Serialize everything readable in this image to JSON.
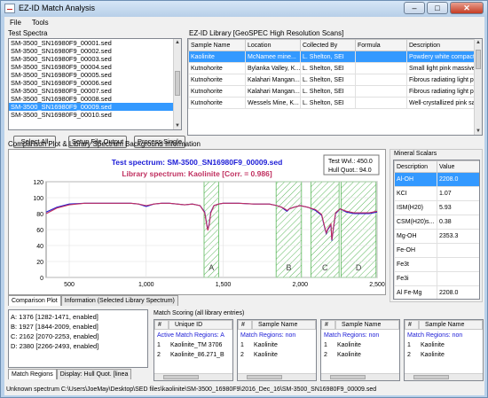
{
  "window": {
    "title": "EZ-ID Match Analysis"
  },
  "menu": {
    "file": "File",
    "tools": "Tools"
  },
  "test_spectra": {
    "label": "Test Spectra",
    "items": [
      "SM-3500_SN16980F9_00001.sed",
      "SM-3500_SN16980F9_00002.sed",
      "SM-3500_SN16980F9_00003.sed",
      "SM-3500_SN16980F9_00004.sed",
      "SM-3500_SN16980F9_00005.sed",
      "SM-3500_SN16980F9_00006.sed",
      "SM-3500_SN16980F9_00007.sed",
      "SM-3500_SN16980F9_00008.sed",
      "SM-3500_SN16980F9_00009.sed",
      "SM-3500_SN16980F9_00010.sed"
    ],
    "selected_index": 8
  },
  "buttons": {
    "select_all": "Select All",
    "setup_file_output": "Setup File Output",
    "process_single": "Process Single"
  },
  "library": {
    "label": "EZ-ID Library [GeoSPEC High Resolution Scans]",
    "columns": [
      "Sample Name",
      "Location",
      "Collected By",
      "Formula",
      "Description"
    ],
    "rows": [
      [
        "Kaolinite",
        "McNamee mine...",
        "L. Shelton, SEI",
        "",
        "Powdery white compact"
      ],
      [
        "Kutnohorite",
        "Bylanka Valley, K...",
        "L. Shelton, SEI",
        "",
        "Small light pink massive"
      ],
      [
        "Kutnohorite",
        "Kalahari Mangan...",
        "L. Shelton, SEI",
        "",
        "Fibrous radiating light pi"
      ],
      [
        "Kutnohorite",
        "Kalahari Mangan...",
        "L. Shelton, SEI",
        "",
        "Fibrous radiating light pi"
      ],
      [
        "Kutnohorite",
        "Wessels Mine, K...",
        "L. Shelton, SEI",
        "",
        "Well-crystallized pink sa"
      ]
    ]
  },
  "comparison": {
    "label": "Comparison Plot & Library Spectrum Background Information"
  },
  "chart_data": {
    "type": "line",
    "title": "Test spectrum: SM-3500_SN16980F9_00009.sed",
    "subtitle": "Library spectrum: Kaolinite [Corr. = 0.986]",
    "info_box": [
      "Test Wvl.: 450.0",
      "Hull Quot.: 94.0"
    ],
    "xlabel": "",
    "ylabel": "",
    "xlim": [
      350,
      2500
    ],
    "ylim": [
      0,
      120
    ],
    "x_ticks": [
      "500",
      "1,000",
      "1,500",
      "2,000",
      "2,500"
    ],
    "y_ticks": [
      "0",
      "20",
      "40",
      "60",
      "80",
      "100",
      "120"
    ],
    "grid": true,
    "match_regions": [
      {
        "label": "A",
        "range": [
          1376,
          1471
        ]
      },
      {
        "label": "B",
        "range": [
          1844,
          2009
        ]
      },
      {
        "label": "C",
        "range": [
          2070,
          2253
        ]
      },
      {
        "label": "D",
        "range": [
          2266,
          2493
        ]
      }
    ],
    "series": [
      {
        "color": "#1a1ad6",
        "x": [
          350,
          420,
          500,
          600,
          700,
          800,
          900,
          950,
          1000,
          1050,
          1100,
          1150,
          1200,
          1250,
          1300,
          1350,
          1380,
          1395,
          1400,
          1410,
          1420,
          1440,
          1470,
          1500,
          1600,
          1700,
          1800,
          1850,
          1880,
          1900,
          1915,
          1930,
          1960,
          2000,
          2050,
          2100,
          2140,
          2160,
          2170,
          2180,
          2200,
          2206,
          2215,
          2230,
          2260,
          2300,
          2350,
          2400,
          2450,
          2500
        ],
        "y": [
          82,
          88,
          92,
          93,
          93,
          93,
          93,
          92,
          89,
          92,
          93,
          93,
          92,
          91,
          92,
          90,
          82,
          65,
          60,
          68,
          82,
          90,
          92,
          93,
          93,
          92,
          92,
          90,
          88,
          85,
          83,
          86,
          88,
          90,
          88,
          84,
          78,
          62,
          55,
          60,
          66,
          46,
          60,
          80,
          86,
          82,
          80,
          80,
          80,
          82
        ]
      },
      {
        "color": "#c03060",
        "x": [
          350,
          420,
          500,
          600,
          700,
          800,
          900,
          950,
          1000,
          1050,
          1100,
          1150,
          1200,
          1250,
          1300,
          1350,
          1380,
          1395,
          1400,
          1410,
          1420,
          1440,
          1470,
          1500,
          1600,
          1700,
          1800,
          1850,
          1880,
          1900,
          1915,
          1930,
          1960,
          2000,
          2050,
          2100,
          2140,
          2160,
          2170,
          2180,
          2200,
          2206,
          2215,
          2230,
          2260,
          2300,
          2350,
          2400,
          2450,
          2500
        ],
        "y": [
          80,
          87,
          91,
          93,
          93,
          93,
          93,
          92,
          90,
          92,
          93,
          93,
          92,
          91,
          92,
          90,
          81,
          64,
          59,
          67,
          81,
          90,
          92,
          93,
          93,
          92,
          92,
          90,
          88,
          86,
          84,
          86,
          88,
          90,
          88,
          85,
          79,
          63,
          56,
          61,
          67,
          47,
          61,
          81,
          86,
          83,
          81,
          81,
          81,
          83
        ]
      }
    ]
  },
  "plot_tabs": [
    "Comparison Plot",
    "Information (Selected Library Spectrum)"
  ],
  "mineral_scalars": {
    "label": "Mineral Scalars",
    "columns": [
      "Description",
      "Value"
    ],
    "rows": [
      [
        "Al-OH",
        "2208.0"
      ],
      [
        "KCI",
        "1.07"
      ],
      [
        "ISM(H20)",
        "5.93"
      ],
      [
        "CSM(H20)s...",
        "0.38"
      ],
      [
        "Mg-OH",
        "2353.3"
      ],
      [
        "Fe-OH",
        ""
      ],
      [
        "Fe3t",
        ""
      ],
      [
        "Fe3i",
        ""
      ],
      [
        "Al Fe-Mg",
        "2208.0"
      ]
    ],
    "selected_index": 0
  },
  "match_regions_list": [
    "A: 1376 [1282-1471, enabled]",
    "B: 1927 [1844-2009, enabled]",
    "C: 2162 [2070-2253, enabled]",
    "D: 2380 [2266-2493, enabled]"
  ],
  "bottom_tabs": [
    "Match Regions",
    "Display: Hull Quot. [linea"
  ],
  "match_scoring": {
    "label": "Match Scoring (all library entries)",
    "panels": [
      {
        "headers": [
          "#",
          "Unique ID"
        ],
        "caption": "Active Match Regions: A",
        "rows": [
          [
            "1",
            "Kaolinite_TM 3706"
          ],
          [
            "2",
            "Kaolinite_86.271_B"
          ]
        ]
      },
      {
        "headers": [
          "#",
          "Sample Name"
        ],
        "caption": "Match Regions: non",
        "rows": [
          [
            "1",
            "Kaolinite"
          ],
          [
            "2",
            "Kaolinite"
          ]
        ]
      },
      {
        "headers": [
          "#",
          "Sample Name"
        ],
        "caption": "Match Regions: non",
        "rows": [
          [
            "1",
            "Kaolinite"
          ],
          [
            "2",
            "Kaolinite"
          ]
        ]
      },
      {
        "headers": [
          "#",
          "Sample Name"
        ],
        "caption": "Match Regions: non",
        "rows": [
          [
            "1",
            "Kaolinite"
          ],
          [
            "2",
            "Kaolinite"
          ]
        ]
      }
    ]
  },
  "status": {
    "text": "Unknown spectrum C:\\Users\\JoeMay\\Desktop\\SED files\\kaolinite\\SM-3500_16980F9\\2016_Dec_16\\SM-3500_SN16980F9_00009.sed"
  }
}
